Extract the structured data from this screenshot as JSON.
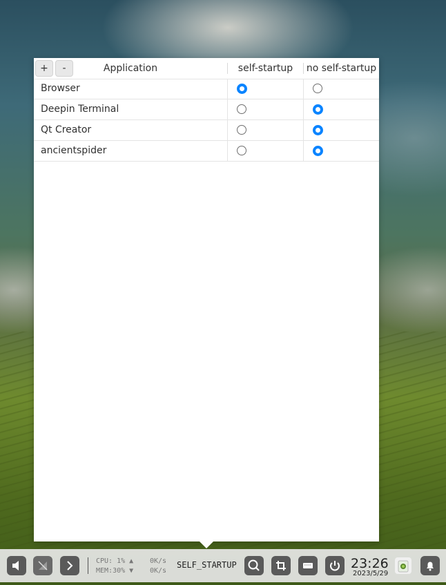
{
  "header": {
    "add_label": "+",
    "remove_label": "-",
    "columns": [
      "Application",
      "self-startup",
      "no self-startup"
    ]
  },
  "rows": [
    {
      "name": "Browser",
      "self_startup": true
    },
    {
      "name": "Deepin Terminal",
      "self_startup": false
    },
    {
      "name": "Qt Creator",
      "self_startup": false
    },
    {
      "name": "ancientspider",
      "self_startup": false
    }
  ],
  "dock": {
    "cpu": "CPU: 1% ▲",
    "mem": "MEM:30% ▼",
    "net_up": "0K/s",
    "net_down": "0K/s",
    "active_app": "SELF_STARTUP",
    "time": "23:26",
    "date": "2023/5/29",
    "icons": [
      "volume-icon",
      "network-icon",
      "chevron-right-icon",
      "search-icon",
      "screenshot-icon",
      "keyboard-icon",
      "power-icon",
      "trash-icon",
      "notification-bell-icon"
    ]
  },
  "colors": {
    "accent": "#0a84ff"
  }
}
